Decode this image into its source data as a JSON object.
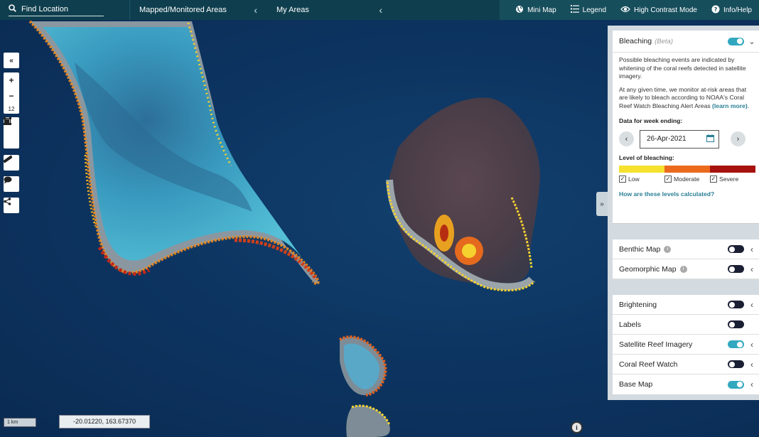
{
  "topbar": {
    "search_placeholder": "Find Location",
    "mapped_label": "Mapped/Monitored Areas",
    "myareas_label": "My Areas",
    "tools": [
      {
        "icon": "globe-icon",
        "label": "Mini Map"
      },
      {
        "icon": "list-icon",
        "label": "Legend"
      },
      {
        "icon": "eye-icon",
        "label": "High Contrast Mode"
      },
      {
        "icon": "help-icon",
        "label": "Info/Help"
      }
    ]
  },
  "map": {
    "zoom_level": "12",
    "scale_label": "1 km",
    "coordinates": "-20.01220, 163.67370"
  },
  "panel": {
    "bleaching": {
      "title": "Bleaching",
      "beta": "(Beta)",
      "enabled": true,
      "desc1": "Possible bleaching events are indicated by whitening of the coral reefs detected in satellite imagery.",
      "desc2": "At any given time, we monitor at-risk areas that are likely to bleach according to NOAA's Coral Reef Watch Bleaching Alert Areas",
      "learn_more": "(learn more)",
      "week_label": "Data for week ending:",
      "date": "26-Apr-2021",
      "level_label": "Level of bleaching:",
      "levels": [
        {
          "label": "Low",
          "color": "#f5e12e",
          "checked": true
        },
        {
          "label": "Moderate",
          "color": "#ec6a1e",
          "checked": true
        },
        {
          "label": "Severe",
          "color": "#a8120e",
          "checked": true
        }
      ],
      "how_link": "How are these levels calculated?"
    },
    "layers1": [
      {
        "label": "Benthic Map",
        "on": false,
        "info": true,
        "expand": true
      },
      {
        "label": "Geomorphic Map",
        "on": false,
        "info": true,
        "expand": true
      }
    ],
    "layers2": [
      {
        "label": "Brightening",
        "on": false,
        "expand": true
      },
      {
        "label": "Labels",
        "on": false,
        "expand": false
      },
      {
        "label": "Satellite Reef Imagery",
        "on": true,
        "expand": true
      },
      {
        "label": "Coral Reef Watch",
        "on": false,
        "expand": true
      },
      {
        "label": "Base Map",
        "on": true,
        "expand": true
      }
    ]
  },
  "colors": {
    "topbar": "#0f3f4e",
    "accent": "#31a8bf",
    "link": "#2a7f95"
  }
}
